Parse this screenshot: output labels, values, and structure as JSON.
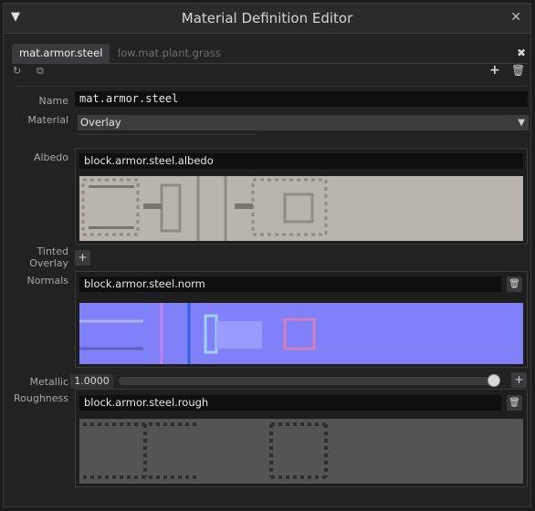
{
  "window": {
    "title": "Material Definition Editor",
    "collapse_glyph": "▼",
    "close_glyph": "✕"
  },
  "tabs": [
    {
      "label": "mat.armor.steel",
      "active": true
    },
    {
      "label": "low.mat.plant.grass",
      "active": false
    }
  ],
  "tabs_close_glyph": "✖",
  "toolbar": {
    "refresh_icon": "↻",
    "copy_icon": "⧉",
    "add_glyph": "+",
    "delete_glyph": "🗑"
  },
  "form": {
    "name_label": "Name",
    "name_value": "mat.armor.steel",
    "material_label": "Material",
    "material_value": "Overlay",
    "albedo_label": "Albedo",
    "albedo_value": "block.armor.steel.albedo",
    "tinted_overlay_label_1": "Tinted",
    "tinted_overlay_label_2": "Overlay",
    "normals_label": "Normals",
    "normals_value": "block.armor.steel.norm",
    "metallic_label": "Metallic",
    "metallic_value": "1.0000",
    "metallic_level": 1.0,
    "roughness_label": "Roughness",
    "roughness_value": "block.armor.steel.rough"
  },
  "colors": {
    "albedo": "#b9b4ad",
    "normal": "#8080f8",
    "rough": "#545454"
  },
  "icons": {
    "plus": "+",
    "trash": "🗑",
    "chevron": "▼"
  }
}
